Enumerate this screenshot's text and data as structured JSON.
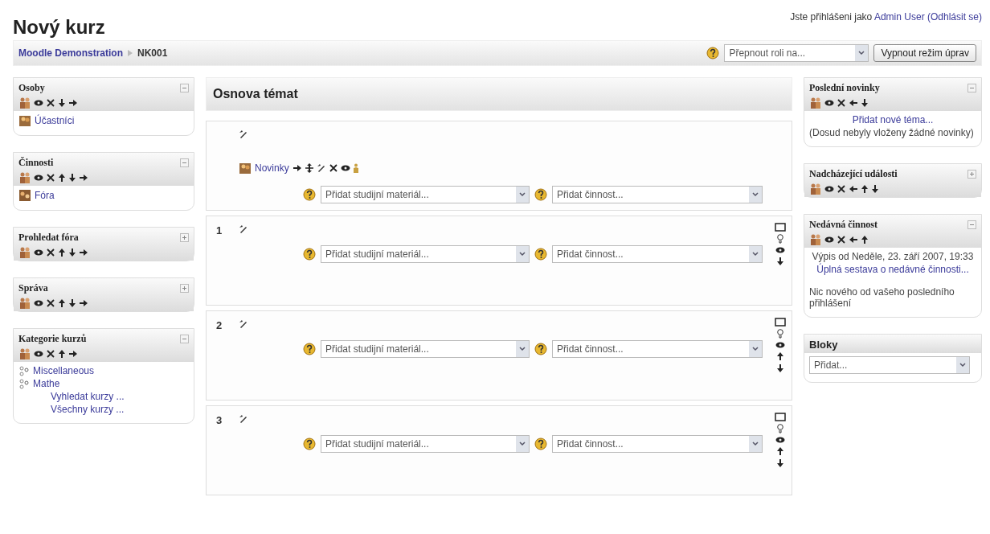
{
  "title": "Nový kurz",
  "login": {
    "prefix": "Jste přihlášeni jako",
    "user": "Admin User",
    "logout": "(Odhlásit se)"
  },
  "breadcrumb": {
    "link": "Moodle Demonstration",
    "current": "NK001"
  },
  "role_select": {
    "value": "Přepnout roli na..."
  },
  "edit_button": "Vypnout režim úprav",
  "left_blocks": [
    {
      "title": "Osoby",
      "expanded": true,
      "controls": [
        {
          "kind": "roles"
        },
        {
          "kind": "hide"
        },
        {
          "kind": "delete"
        },
        {
          "kind": "down"
        },
        {
          "kind": "right"
        }
      ],
      "items": [
        {
          "kind": "people",
          "label": "Účastníci"
        }
      ]
    },
    {
      "title": "Činnosti",
      "expanded": true,
      "controls": [
        {
          "kind": "roles"
        },
        {
          "kind": "hide"
        },
        {
          "kind": "delete"
        },
        {
          "kind": "up"
        },
        {
          "kind": "down"
        },
        {
          "kind": "right"
        }
      ],
      "items": [
        {
          "kind": "forum",
          "label": "Fóra"
        }
      ]
    },
    {
      "title": "Prohledat fóra",
      "expanded": false,
      "controls": [
        {
          "kind": "roles"
        },
        {
          "kind": "hide"
        },
        {
          "kind": "delete"
        },
        {
          "kind": "up"
        },
        {
          "kind": "down"
        },
        {
          "kind": "right"
        }
      ]
    },
    {
      "title": "Správa",
      "expanded": false,
      "controls": [
        {
          "kind": "roles"
        },
        {
          "kind": "hide"
        },
        {
          "kind": "delete"
        },
        {
          "kind": "up"
        },
        {
          "kind": "down"
        },
        {
          "kind": "right"
        }
      ]
    },
    {
      "title": "Kategorie kurzů",
      "expanded": true,
      "controls": [
        {
          "kind": "roles"
        },
        {
          "kind": "hide"
        },
        {
          "kind": "delete"
        },
        {
          "kind": "up"
        },
        {
          "kind": "right"
        }
      ],
      "items": [
        {
          "kind": "category",
          "label": "Miscellaneous"
        },
        {
          "kind": "category",
          "label": "Mathe"
        }
      ],
      "links": [
        "Vyhledat kurzy ...",
        "Všechny kurzy ..."
      ]
    }
  ],
  "outline": {
    "title": "Osnova témat",
    "sections": [
      {
        "resources": [
          {
            "label": "Novinky",
            "controls": [
              {
                "kind": "right"
              },
              {
                "kind": "move"
              },
              {
                "kind": "edit"
              },
              {
                "kind": "delete"
              },
              {
                "kind": "hide"
              },
              {
                "kind": "group"
              }
            ]
          }
        ],
        "material": "Přidat studijní materiál...",
        "activity": "Přidat činnost..."
      },
      {
        "number": "1",
        "material": "Přidat studijní materiál...",
        "activity": "Přidat činnost...",
        "side": [
          {
            "kind": "marker"
          },
          {
            "kind": "highlight"
          },
          {
            "kind": "hide"
          },
          {
            "kind": "down"
          }
        ]
      },
      {
        "number": "2",
        "material": "Přidat studijní materiál...",
        "activity": "Přidat činnost...",
        "side": [
          {
            "kind": "marker"
          },
          {
            "kind": "highlight"
          },
          {
            "kind": "hide"
          },
          {
            "kind": "up"
          },
          {
            "kind": "down"
          }
        ]
      },
      {
        "number": "3",
        "material": "Přidat studijní materiál...",
        "activity": "Přidat činnost...",
        "side": [
          {
            "kind": "marker"
          },
          {
            "kind": "highlight"
          },
          {
            "kind": "hide"
          },
          {
            "kind": "up"
          },
          {
            "kind": "down"
          }
        ]
      }
    ]
  },
  "right_blocks": [
    {
      "title": "Poslední novinky",
      "expanded": true,
      "controls": [
        {
          "kind": "roles"
        },
        {
          "kind": "hide"
        },
        {
          "kind": "delete"
        },
        {
          "kind": "left"
        },
        {
          "kind": "down"
        }
      ],
      "links": [
        "Přidat nové téma..."
      ],
      "texts": [
        "(Dosud nebyly vloženy žádné novinky)"
      ]
    },
    {
      "title": "Nadcházející události",
      "expanded": false,
      "controls": [
        {
          "kind": "roles"
        },
        {
          "kind": "hide"
        },
        {
          "kind": "delete"
        },
        {
          "kind": "left"
        },
        {
          "kind": "up"
        },
        {
          "kind": "down"
        }
      ]
    },
    {
      "title": "Nedávná činnost",
      "expanded": true,
      "controls": [
        {
          "kind": "roles"
        },
        {
          "kind": "hide"
        },
        {
          "kind": "delete"
        },
        {
          "kind": "left"
        },
        {
          "kind": "up"
        }
      ],
      "centered": [
        "Výpis od Neděle, 23. září 2007, 19:33"
      ],
      "links": [
        "Úplná sestava o nedávné činnosti..."
      ],
      "texts": [
        "Nic nového od vašeho posledního přihlášení"
      ]
    },
    {
      "title": "Bloky",
      "select": "Přidat..."
    }
  ]
}
